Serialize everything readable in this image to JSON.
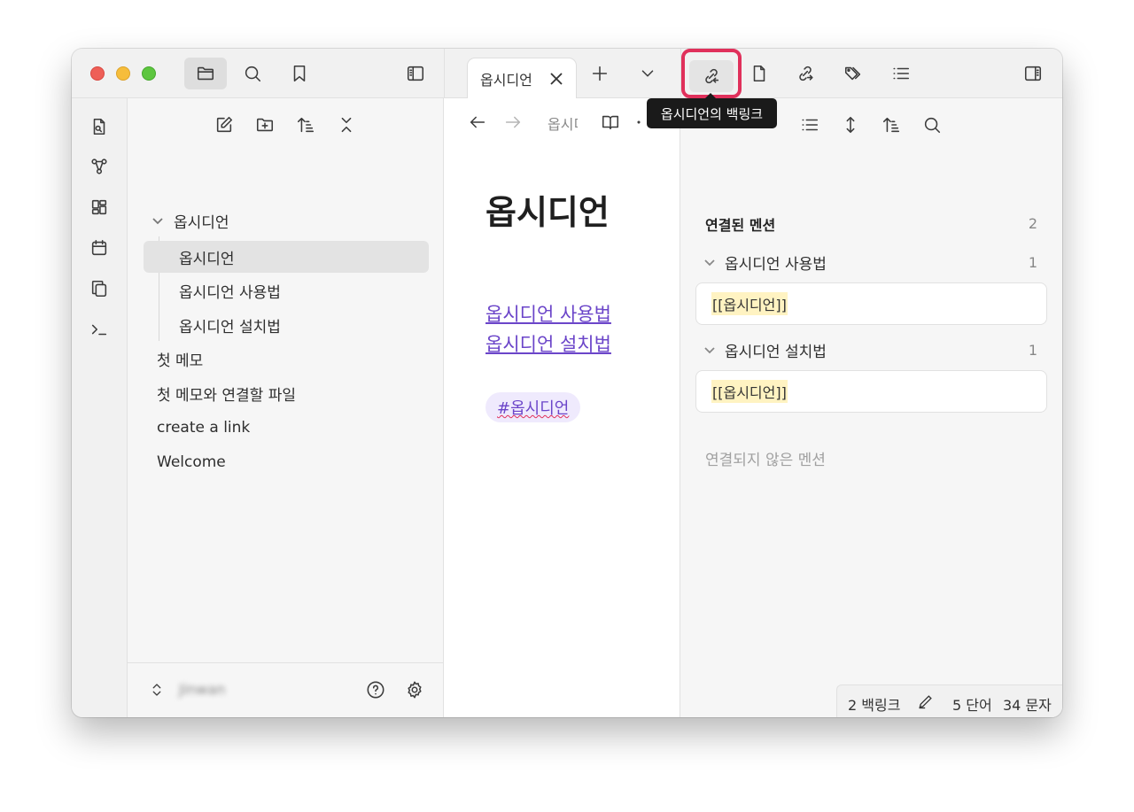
{
  "tab": {
    "title": "옵시디언",
    "tooltip": "옵시디언의 백링크"
  },
  "explorer": {
    "tree": [
      {
        "label": "옵시디언",
        "folder": true
      },
      {
        "label": "옵시디언",
        "active": true
      },
      {
        "label": "옵시디언 사용법"
      },
      {
        "label": "옵시디언 설치법"
      },
      {
        "label": "첫 메모"
      },
      {
        "label": "첫 메모와 연결할 파일"
      },
      {
        "label": "create a link"
      },
      {
        "label": "Welcome"
      }
    ],
    "vault_name": "Jinwan"
  },
  "editor": {
    "breadcrumb": "옵시디언",
    "heading": "옵시디언",
    "links": [
      "옵시디언 사용법",
      "옵시디언 설치법"
    ],
    "tag": "#옵시디언"
  },
  "backlinks": {
    "linked_heading": "연결된 멘션",
    "linked_count": "2",
    "groups": [
      {
        "title": "옵시디언 사용법",
        "count": "1",
        "snippet": "[[옵시디언]]"
      },
      {
        "title": "옵시디언 설치법",
        "count": "1",
        "snippet": "[[옵시디언]]"
      }
    ],
    "unlinked_heading": "연결되지 않은 멘션"
  },
  "status": {
    "backlinks": "2 백링크",
    "words": "5 단어",
    "chars": "34 문자"
  },
  "colors": {
    "accent": "#6b45c9",
    "highlight": "#e0305b",
    "tag_bg": "#efeafd"
  }
}
